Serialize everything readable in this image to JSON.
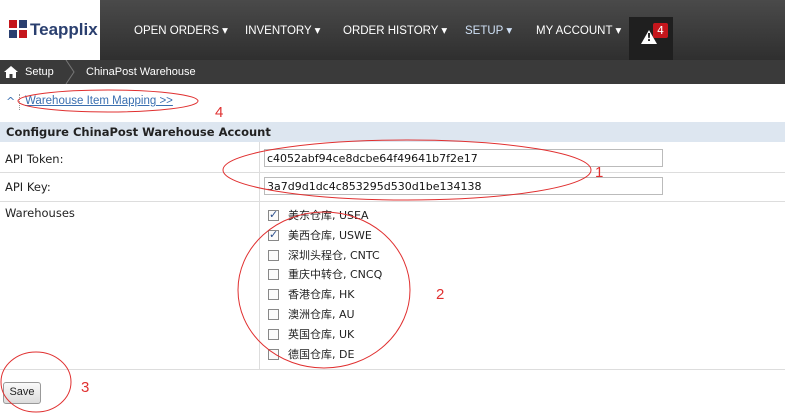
{
  "brand": {
    "name": "Teapplix"
  },
  "nav": [
    {
      "label": "OPEN ORDERS ▾"
    },
    {
      "label": "INVENTORY ▾"
    },
    {
      "label": "ORDER HISTORY ▾"
    },
    {
      "label": "SETUP ▾"
    },
    {
      "label": "MY ACCOUNT ▾"
    }
  ],
  "alerts": {
    "count": "4"
  },
  "breadcrumb": {
    "parent": "Setup",
    "current": "ChinaPost Warehouse"
  },
  "mapping_link": "Warehouse Item Mapping >>",
  "section_title": "Configure ChinaPost Warehouse Account",
  "api_token": {
    "label": "API Token:",
    "value": "c4052abf94ce8dcbe64f49641b7f2e17"
  },
  "api_key": {
    "label": "API Key:",
    "value": "3a7d9d1dc4c853295d530d1be134138"
  },
  "warehouses": {
    "label": "Warehouses",
    "items": [
      {
        "label": "美东仓库, USEA",
        "checked": true
      },
      {
        "label": "美西仓库, USWE",
        "checked": true
      },
      {
        "label": "深圳头程仓, CNTC",
        "checked": false
      },
      {
        "label": "重庆中转仓, CNCQ",
        "checked": false
      },
      {
        "label": "香港仓库, HK",
        "checked": false
      },
      {
        "label": "澳洲仓库, AU",
        "checked": false
      },
      {
        "label": "英国仓库, UK",
        "checked": false
      },
      {
        "label": "德国仓库, DE",
        "checked": false
      }
    ]
  },
  "save_label": "Save",
  "annotations": [
    "1",
    "2",
    "3",
    "4"
  ],
  "colors": {
    "annotation": "#e03030",
    "link": "#3a6fb0",
    "header_bg": "#dde6f0",
    "badge": "#c4161c"
  }
}
